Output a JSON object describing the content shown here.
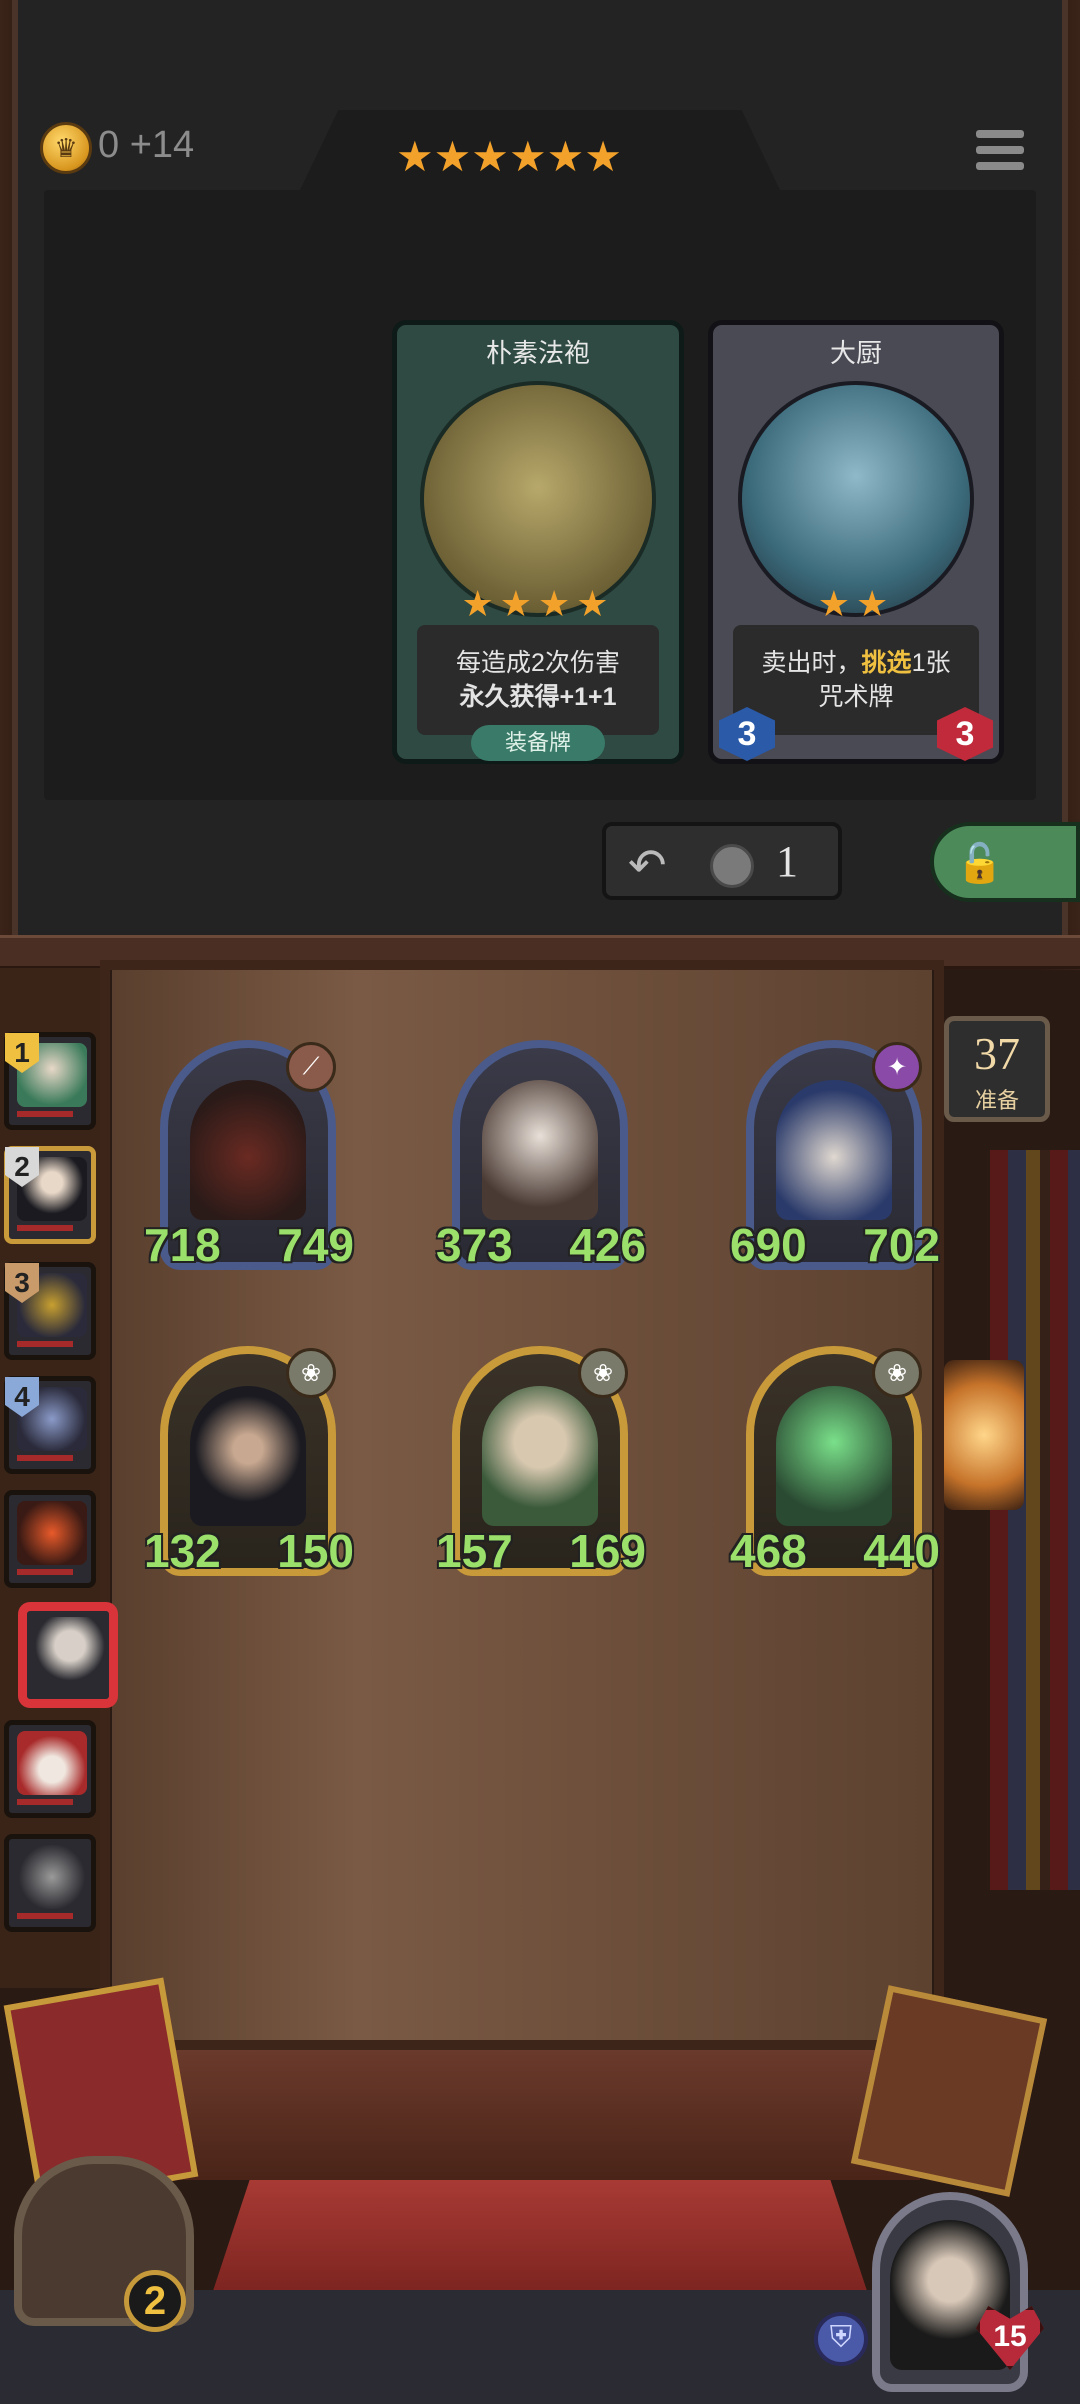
{
  "header": {
    "gold": "0 +14",
    "gold_icon": "crown-coin-icon",
    "stars": "★★★★★★",
    "menu_icon": "menu-icon"
  },
  "shop": {
    "cards": [
      {
        "name": "朴素法袍",
        "stars": "★★★★",
        "desc_line1": "每造成2次伤害",
        "desc_line2": "永久获得+1+1",
        "tag": "装备牌"
      },
      {
        "name": "大厨",
        "stars": "★★",
        "desc_part1": "卖出时，",
        "desc_highlight": "挑选",
        "desc_part2": "1张",
        "desc_line2": "咒术牌",
        "attack": "3",
        "health": "3"
      }
    ],
    "refresh_cost": "1",
    "refresh_icon": "refresh-icon",
    "freeze_icon": "lock-icon"
  },
  "turn": {
    "number": "37",
    "label": "准备"
  },
  "board": {
    "units": [
      {
        "attack": "718",
        "health": "749"
      },
      {
        "attack": "373",
        "health": "426"
      },
      {
        "attack": "690",
        "health": "702"
      },
      {
        "attack": "132",
        "health": "150"
      },
      {
        "attack": "157",
        "health": "169"
      },
      {
        "attack": "468",
        "health": "440"
      }
    ]
  },
  "roster": {
    "ranks": [
      "1",
      "2",
      "3",
      "4"
    ]
  },
  "bottom": {
    "chest_count": "2",
    "player_health": "15"
  },
  "colors": {
    "star": "#f2a12a",
    "stat_green": "#9be06a",
    "highlight": "#f0c040"
  }
}
